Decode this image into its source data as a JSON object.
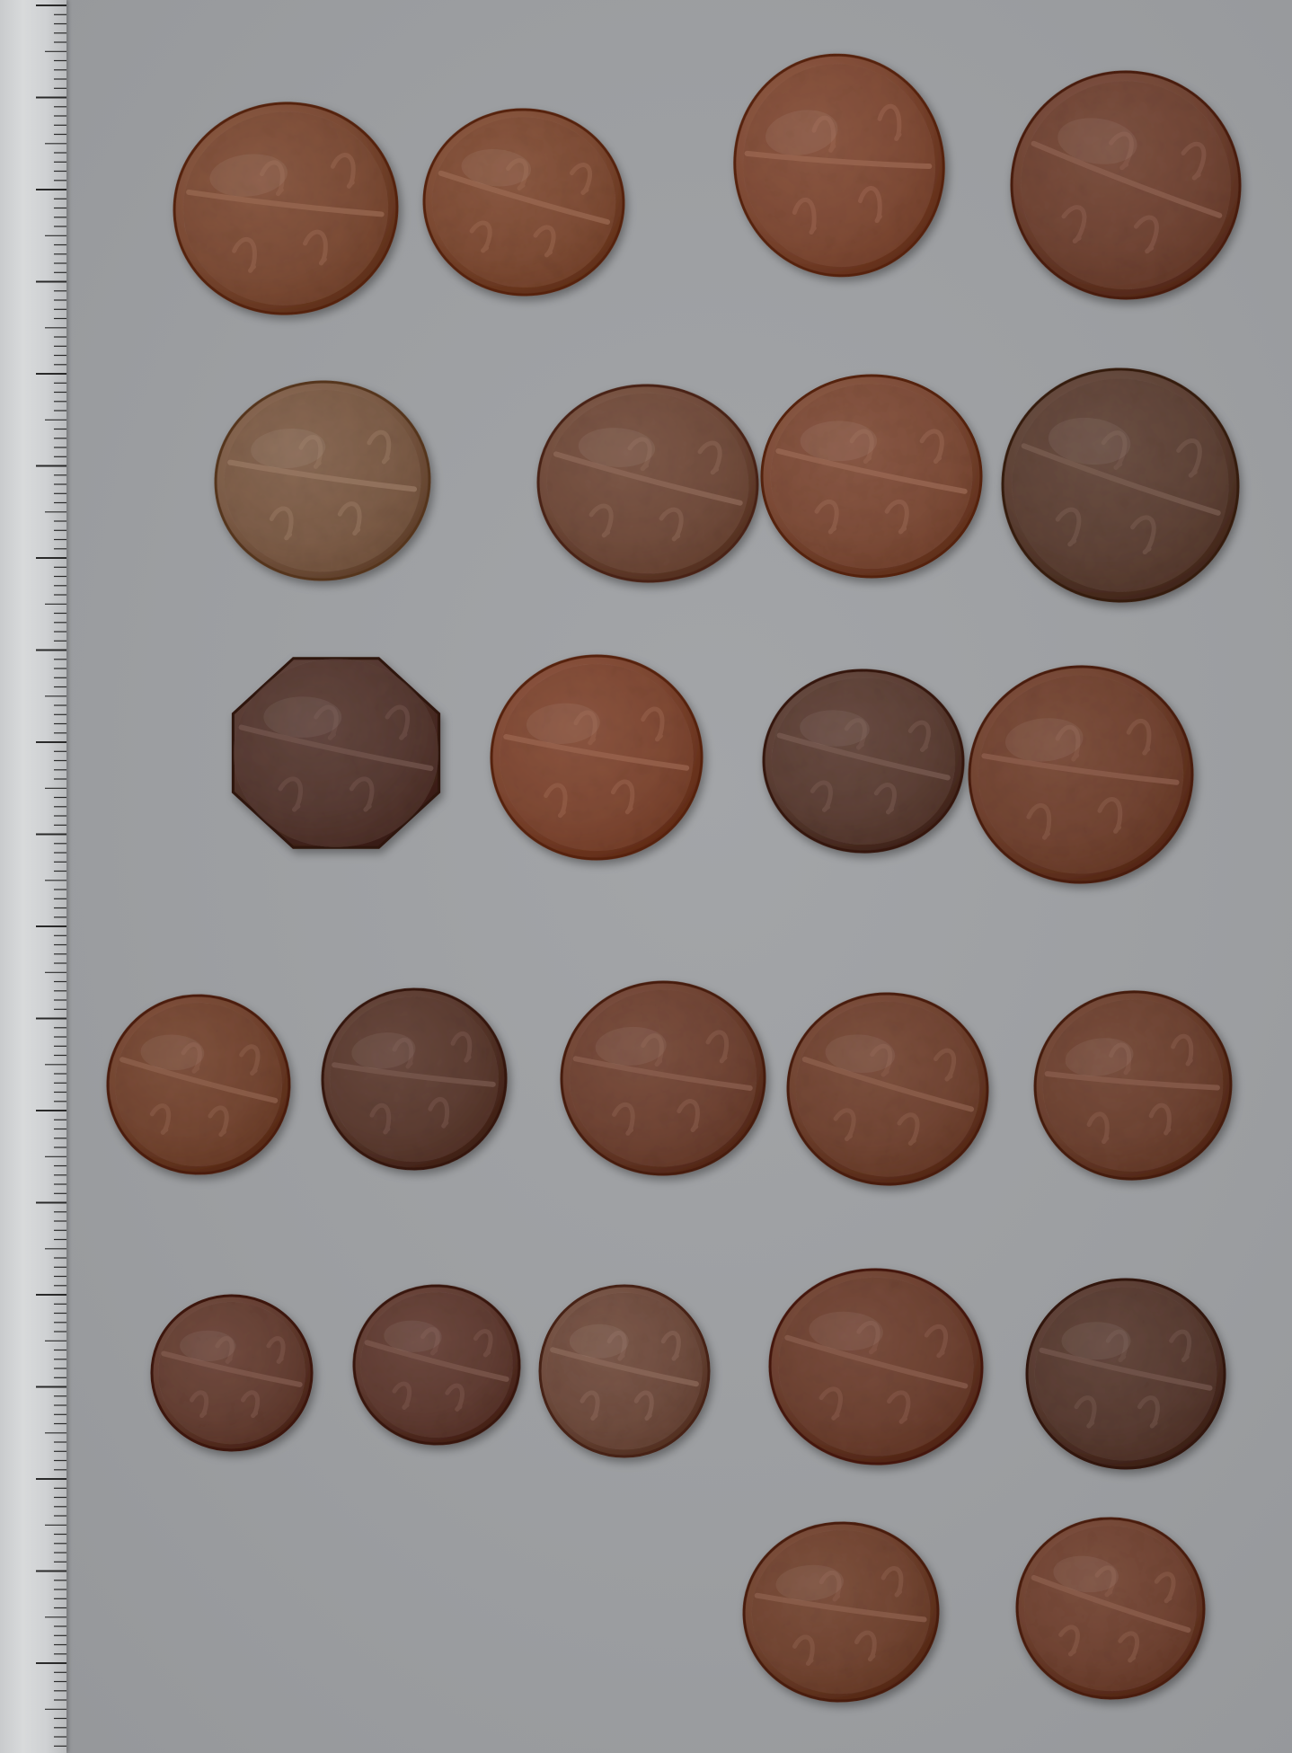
{
  "scene": {
    "background_color": "#9c9ea1",
    "ruler_color": "#d3d5d6",
    "tick_color": "#2a2a2a"
  },
  "coins": [
    {
      "id": "coin-01",
      "tone": "#7a4a34",
      "shape": "round",
      "row": 1
    },
    {
      "id": "coin-02",
      "tone": "#7c4a33",
      "shape": "round",
      "row": 1
    },
    {
      "id": "coin-03",
      "tone": "#7d4934",
      "shape": "round",
      "row": 1
    },
    {
      "id": "coin-04",
      "tone": "#6e4232",
      "shape": "round",
      "row": 1
    },
    {
      "id": "coin-05",
      "tone": "#7a5a45",
      "shape": "round",
      "row": 2
    },
    {
      "id": "coin-06",
      "tone": "#6f4a3a",
      "shape": "round",
      "row": 2
    },
    {
      "id": "coin-07",
      "tone": "#7b4a36",
      "shape": "round",
      "row": 2
    },
    {
      "id": "coin-08",
      "tone": "#5c4034",
      "shape": "round",
      "row": 2
    },
    {
      "id": "coin-09",
      "tone": "#553830",
      "shape": "octagonal",
      "row": 3
    },
    {
      "id": "coin-10",
      "tone": "#7c4631",
      "shape": "round",
      "row": 3
    },
    {
      "id": "coin-11",
      "tone": "#5a3d33",
      "shape": "round",
      "row": 3
    },
    {
      "id": "coin-12",
      "tone": "#6f412f",
      "shape": "round",
      "row": 3
    },
    {
      "id": "coin-13",
      "tone": "#71432f",
      "shape": "round",
      "row": 4
    },
    {
      "id": "coin-14",
      "tone": "#5a3a2f",
      "shape": "round",
      "row": 4
    },
    {
      "id": "coin-15",
      "tone": "#6d4131",
      "shape": "round",
      "row": 4
    },
    {
      "id": "coin-16",
      "tone": "#6f4230",
      "shape": "round",
      "row": 4
    },
    {
      "id": "coin-17",
      "tone": "#6b402f",
      "shape": "round",
      "row": 4
    },
    {
      "id": "coin-18",
      "tone": "#633d31",
      "shape": "round",
      "row": 5
    },
    {
      "id": "coin-19",
      "tone": "#5e3a30",
      "shape": "round",
      "row": 5
    },
    {
      "id": "coin-20",
      "tone": "#6d4a3c",
      "shape": "round",
      "row": 5
    },
    {
      "id": "coin-21",
      "tone": "#6b3f2f",
      "shape": "round",
      "row": 5
    },
    {
      "id": "coin-22",
      "tone": "#56392f",
      "shape": "round",
      "row": 5
    },
    {
      "id": "coin-23",
      "tone": "#6f422f",
      "shape": "round",
      "row": 6
    },
    {
      "id": "coin-24",
      "tone": "#6e4130",
      "shape": "round",
      "row": 6
    }
  ]
}
